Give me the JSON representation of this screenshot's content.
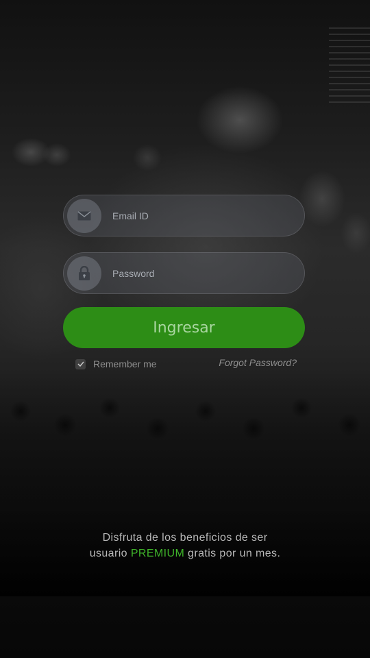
{
  "login": {
    "email_placeholder": "Email ID",
    "password_placeholder": "Password",
    "submit_label": "Ingresar",
    "remember_label": "Remember me",
    "remember_checked": true,
    "forgot_label": "Forgot Password?"
  },
  "promo": {
    "line1": "Disfruta de los beneficios de ser",
    "line2_prefix": "usuario",
    "line2_highlight": "PREMIUM",
    "line2_suffix": "gratis por un mes."
  },
  "icons": {
    "email": "envelope-icon",
    "password": "lock-icon",
    "remember": "checkmark-icon"
  },
  "colors": {
    "accent": "#2d8d16",
    "highlight": "#3fb52a"
  }
}
